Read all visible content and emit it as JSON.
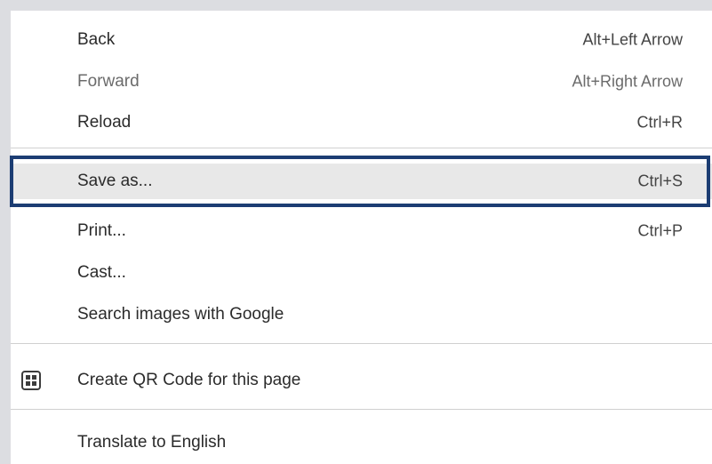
{
  "menu": {
    "items": [
      {
        "label": "Back",
        "shortcut": "Alt+Left Arrow",
        "enabled": true
      },
      {
        "label": "Forward",
        "shortcut": "Alt+Right Arrow",
        "enabled": false
      },
      {
        "label": "Reload",
        "shortcut": "Ctrl+R",
        "enabled": true
      },
      {
        "label": "Save as...",
        "shortcut": "Ctrl+S",
        "enabled": true,
        "highlighted": true
      },
      {
        "label": "Print...",
        "shortcut": "Ctrl+P",
        "enabled": true
      },
      {
        "label": "Cast...",
        "enabled": true
      },
      {
        "label": "Search images with Google",
        "enabled": true
      },
      {
        "label": "Create QR Code for this page",
        "icon": "qr-code-icon",
        "enabled": true
      },
      {
        "label": "Translate to English",
        "enabled": true
      }
    ]
  },
  "colors": {
    "highlight_border": "#1c3d73",
    "highlight_background": "#e8e8e8",
    "background": "#dcdde1"
  }
}
